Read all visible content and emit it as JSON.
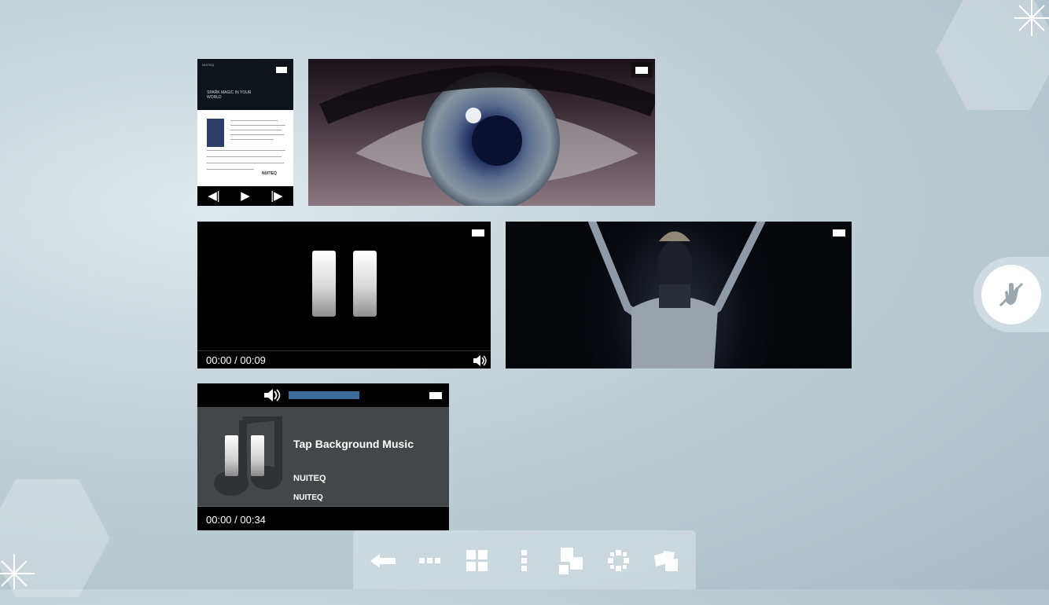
{
  "document": {
    "brand": "NUITEQ",
    "headline": "SPARK MAGIC IN YOUR WORLD",
    "logo": "NUITEQ",
    "controls": {
      "prev": "◀|",
      "play": "▶",
      "next": "|▶"
    }
  },
  "video": {
    "time": "00:00 / 00:09"
  },
  "music": {
    "title": "Tap Background Music",
    "artist": "NUITEQ",
    "album": "NUITEQ",
    "time": "00:00 / 00:34",
    "volume_level": 1.0
  },
  "icons": {
    "fullscreen": "fullscreen-icon",
    "volume": "volume-icon",
    "pause": "pause-icon"
  },
  "toolbar": {
    "items": [
      {
        "name": "back-icon"
      },
      {
        "name": "horizontal-dots-icon"
      },
      {
        "name": "grid-icon"
      },
      {
        "name": "vertical-dots-icon"
      },
      {
        "name": "stack-icon"
      },
      {
        "name": "circle-arrange-icon"
      },
      {
        "name": "scatter-icon"
      }
    ]
  },
  "side_handle": {
    "icon": "no-touch-icon"
  },
  "colors": {
    "accent": "#3c6b9c",
    "background": "#b7c8cf"
  }
}
